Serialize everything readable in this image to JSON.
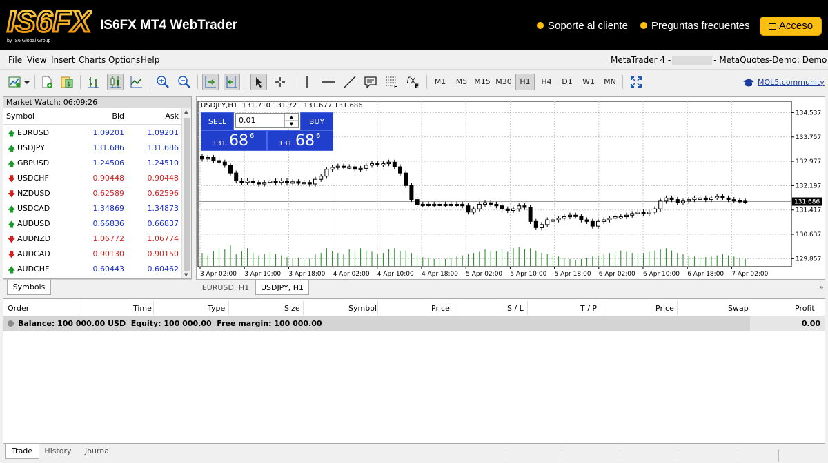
{
  "header": {
    "logo_text": "IS6FX",
    "logo_sub": "by IS6 Global Group",
    "app_title": "IS6FX MT4 WebTrader",
    "support_link": "Soporte al cliente",
    "faq_link": "Preguntas frecuentes",
    "access_button": "Acceso",
    "accent": "#fbbf0f"
  },
  "menu": {
    "items": [
      "File",
      "View",
      "Insert",
      "Charts",
      "Options",
      "Help"
    ],
    "account_prefix": "MetaTrader 4 -",
    "account_suffix": "- MetaQuotes-Demo: Demo Account"
  },
  "toolbar": {
    "timeframes": [
      "M1",
      "M5",
      "M15",
      "M30",
      "H1",
      "H4",
      "D1",
      "W1",
      "MN"
    ],
    "selected_timeframe": "H1",
    "mql_link": "MQL5.community"
  },
  "market_watch": {
    "title": "Market Watch: 06:09:26",
    "columns": {
      "symbol": "Symbol",
      "bid": "Bid",
      "ask": "Ask"
    },
    "rows": [
      {
        "symbol": "EURUSD",
        "bid": "1.09201",
        "ask": "1.09201",
        "dir": "up"
      },
      {
        "symbol": "USDJPY",
        "bid": "131.686",
        "ask": "131.686",
        "dir": "up"
      },
      {
        "symbol": "GBPUSD",
        "bid": "1.24506",
        "ask": "1.24510",
        "dir": "up"
      },
      {
        "symbol": "USDCHF",
        "bid": "0.90448",
        "ask": "0.90448",
        "dir": "down"
      },
      {
        "symbol": "NZDUSD",
        "bid": "0.62589",
        "ask": "0.62596",
        "dir": "down"
      },
      {
        "symbol": "USDCAD",
        "bid": "1.34869",
        "ask": "1.34873",
        "dir": "up"
      },
      {
        "symbol": "AUDUSD",
        "bid": "0.66836",
        "ask": "0.66837",
        "dir": "up"
      },
      {
        "symbol": "AUDNZD",
        "bid": "1.06772",
        "ask": "1.06774",
        "dir": "down"
      },
      {
        "symbol": "AUDCAD",
        "bid": "0.90130",
        "ask": "0.90150",
        "dir": "down"
      },
      {
        "symbol": "AUDCHF",
        "bid": "0.60443",
        "ask": "0.60462",
        "dir": "up"
      }
    ],
    "tab": "Symbols"
  },
  "one_click": {
    "sell_label": "SELL",
    "buy_label": "BUY",
    "lot": "0.01",
    "sell_price_small": "131.",
    "sell_price_big": "68",
    "sell_price_sup": "6",
    "buy_price_small": "131.",
    "buy_price_big": "68",
    "buy_price_sup": "6"
  },
  "chart_tabs": [
    "EURUSD, H1",
    "USDJPY, H1"
  ],
  "chart_tabs_active": 1,
  "chart_data": {
    "type": "candlestick",
    "header": "USDJPY,H1  131.710 131.721 131.677 131.686",
    "y_ticks": [
      "134.537",
      "133.757",
      "132.977",
      "132.197",
      "131.417",
      "130.637",
      "129.857"
    ],
    "y_tick_values": [
      134.537,
      133.757,
      132.977,
      132.197,
      131.417,
      130.637,
      129.857
    ],
    "current_price": "131.686",
    "current_value": 131.686,
    "ylim": [
      129.6,
      134.9
    ],
    "x_ticks": [
      "3 Apr 02:00",
      "3 Apr 10:00",
      "3 Apr 18:00",
      "4 Apr 02:00",
      "4 Apr 10:00",
      "4 Apr 18:00",
      "5 Apr 02:00",
      "5 Apr 10:00",
      "5 Apr 18:00",
      "6 Apr 02:00",
      "6 Apr 10:00",
      "6 Apr 18:00",
      "7 Apr 02:00"
    ],
    "candle_closes": [
      133.05,
      133.1,
      133.0,
      132.95,
      132.85,
      132.6,
      132.35,
      132.3,
      132.35,
      132.3,
      132.25,
      132.3,
      132.35,
      132.3,
      132.35,
      132.3,
      132.32,
      132.3,
      132.3,
      132.25,
      132.4,
      132.5,
      132.72,
      132.78,
      132.82,
      132.8,
      132.8,
      132.72,
      132.75,
      132.85,
      132.9,
      132.88,
      132.9,
      132.95,
      132.8,
      132.6,
      132.2,
      131.75,
      131.6,
      131.6,
      131.58,
      131.6,
      131.58,
      131.6,
      131.58,
      131.6,
      131.55,
      131.35,
      131.45,
      131.6,
      131.65,
      131.6,
      131.55,
      131.45,
      131.4,
      131.45,
      131.55,
      131.5,
      131.05,
      130.85,
      130.95,
      131.1,
      131.1,
      131.15,
      131.2,
      131.25,
      131.22,
      131.1,
      131.05,
      130.9,
      131.05,
      131.1,
      131.15,
      131.2,
      131.2,
      131.25,
      131.3,
      131.35,
      131.3,
      131.35,
      131.45,
      131.7,
      131.8,
      131.75,
      131.65,
      131.7,
      131.75,
      131.8,
      131.8,
      131.75,
      131.8,
      131.85,
      131.8,
      131.75,
      131.72,
      131.7,
      131.686
    ],
    "volumes": [
      22,
      18,
      25,
      30,
      28,
      35,
      20,
      25,
      30,
      22,
      18,
      20,
      24,
      20,
      18,
      15,
      12,
      14,
      10,
      12,
      20,
      22,
      30,
      25,
      22,
      20,
      28,
      24,
      30,
      26,
      24,
      20,
      22,
      28,
      30,
      25,
      26,
      22,
      18,
      15,
      14,
      12,
      10,
      12,
      14,
      16,
      18,
      20,
      22,
      24,
      28,
      26,
      25,
      28,
      24,
      30,
      32,
      28,
      30,
      26,
      22,
      20,
      18,
      16,
      14,
      12,
      10,
      12,
      14,
      16,
      18,
      20,
      22,
      24,
      26,
      24,
      22,
      20,
      22,
      24,
      26,
      28,
      30,
      26,
      22,
      20,
      18,
      16,
      14,
      15,
      16,
      18,
      20,
      18,
      16,
      14,
      12
    ],
    "colors": {
      "candle": "#000000",
      "volume": "#1a8a1a",
      "grid": "#c8c8c8"
    }
  },
  "trade": {
    "columns": [
      "Order",
      "Time",
      "Type",
      "Size",
      "Symbol",
      "Price",
      "S / L",
      "T / P",
      "Price",
      "Swap",
      "Profit"
    ],
    "balance_text": "Balance: 100 000.00 USD  Equity: 100 000.00  Free margin: 100 000.00",
    "profit": "0.00"
  },
  "bottom_tabs": [
    "Trade",
    "History",
    "Journal"
  ]
}
